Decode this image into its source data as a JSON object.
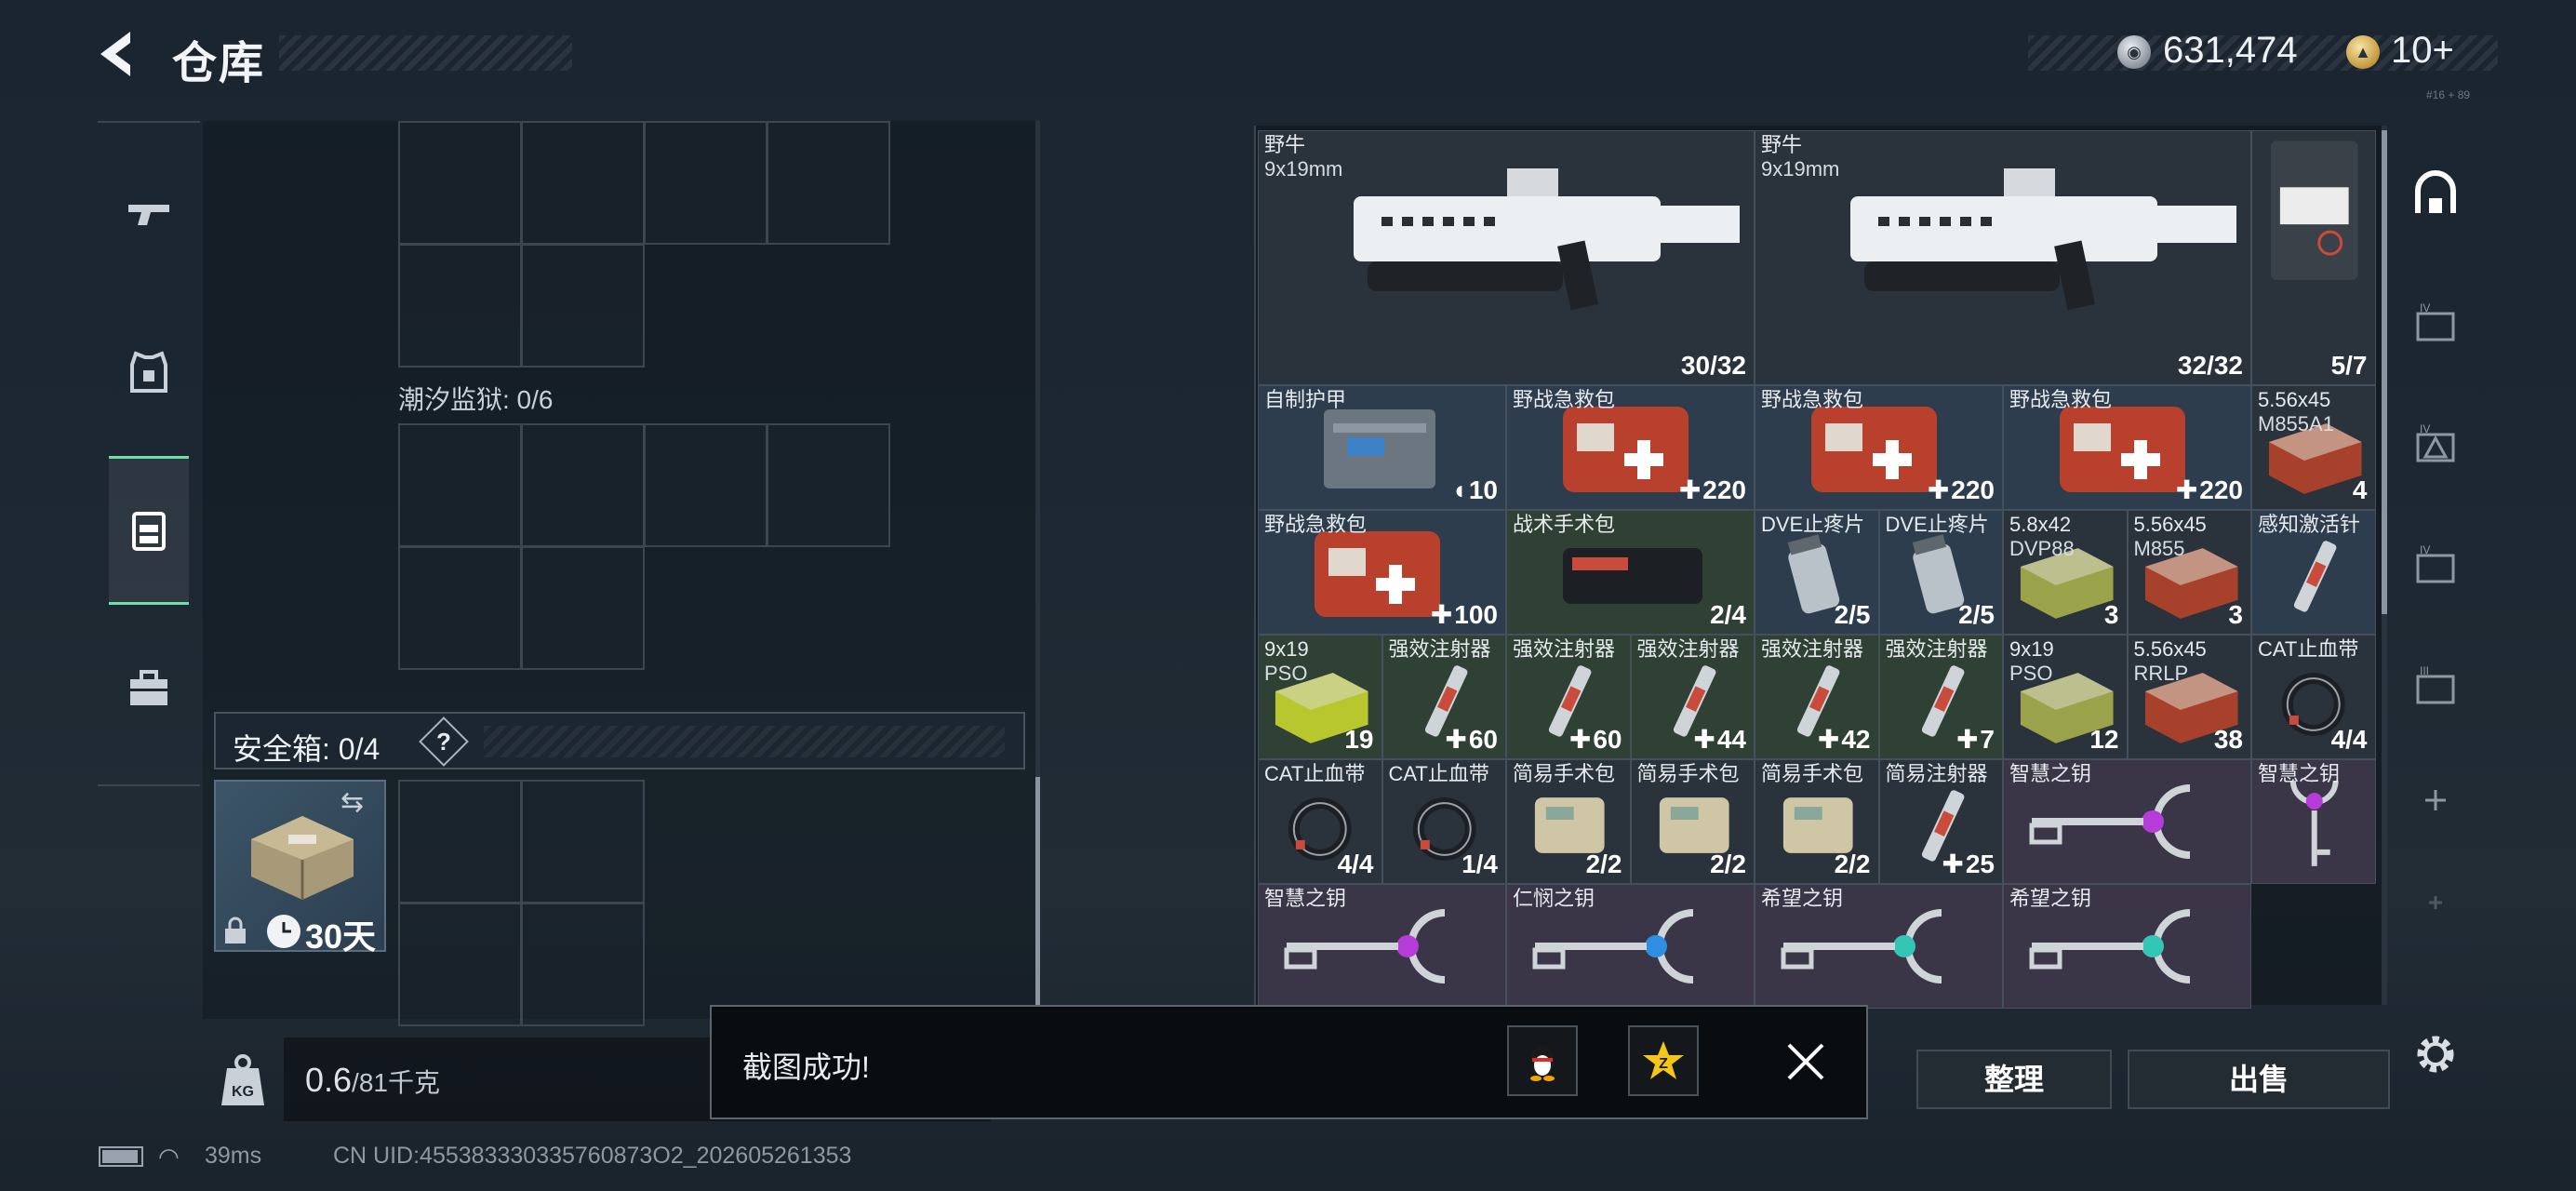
{
  "header": {
    "title": "仓库",
    "silver_amount": "631,474",
    "gold_amount": "10+",
    "version": "#16 + 89"
  },
  "left_panel": {
    "tide_prison_label": "潮汐监狱: 0/6",
    "safe_box_label": "安全箱: 0/4",
    "safe_box_help": "?",
    "safe_box_days": "30天",
    "weight_value": "0.6",
    "weight_unit": "/81千克"
  },
  "status_bar": {
    "ping": "39ms",
    "uid": "CN UID:455383330335760873O2_202605261353"
  },
  "items": [
    {
      "name": "野牛",
      "sub": "9x19mm",
      "count": "30/32",
      "style": "dark"
    },
    {
      "name": "野牛",
      "sub": "9x19mm",
      "count": "32/32",
      "style": "dark"
    },
    {
      "name": "",
      "sub": "",
      "count": "5/7",
      "style": "dark"
    },
    {
      "name": "自制护甲",
      "sub": "",
      "count": "10",
      "style": "blue"
    },
    {
      "name": "野战急救包",
      "sub": "",
      "count": "220",
      "style": "blue"
    },
    {
      "name": "野战急救包",
      "sub": "",
      "count": "220",
      "style": "blue"
    },
    {
      "name": "野战急救包",
      "sub": "",
      "count": "220",
      "style": "blue"
    },
    {
      "name": "5.56x45",
      "sub": "M855A1",
      "count": "4",
      "style": "dark"
    },
    {
      "name": "野战急救包",
      "sub": "",
      "count": "100",
      "style": "blue"
    },
    {
      "name": "战术手术包",
      "sub": "",
      "count": "2/4",
      "style": "green"
    },
    {
      "name": "DVE止疼片",
      "sub": "",
      "count": "2/5",
      "style": "blue"
    },
    {
      "name": "DVE止疼片",
      "sub": "",
      "count": "2/5",
      "style": "blue"
    },
    {
      "name": "5.8x42",
      "sub": "DVP88",
      "count": "3",
      "style": "dark"
    },
    {
      "name": "5.56x45",
      "sub": "M855",
      "count": "3",
      "style": "dark"
    },
    {
      "name": "感知激活针",
      "sub": "",
      "count": "",
      "style": "blue"
    },
    {
      "name": "9x19",
      "sub": "PSO",
      "count": "19",
      "style": "green"
    },
    {
      "name": "强效注射器",
      "sub": "",
      "count": "60",
      "style": "green"
    },
    {
      "name": "强效注射器",
      "sub": "",
      "count": "60",
      "style": "green"
    },
    {
      "name": "强效注射器",
      "sub": "",
      "count": "44",
      "style": "green"
    },
    {
      "name": "强效注射器",
      "sub": "",
      "count": "42",
      "style": "green"
    },
    {
      "name": "强效注射器",
      "sub": "",
      "count": "7",
      "style": "green"
    },
    {
      "name": "9x19",
      "sub": "PSO",
      "count": "12",
      "style": "dark"
    },
    {
      "name": "5.56x45",
      "sub": "RRLP",
      "count": "38",
      "style": "dark"
    },
    {
      "name": "CAT止血带",
      "sub": "",
      "count": "4/4",
      "style": "dark"
    },
    {
      "name": "CAT止血带",
      "sub": "",
      "count": "4/4",
      "style": "dark"
    },
    {
      "name": "CAT止血带",
      "sub": "",
      "count": "1/4",
      "style": "dark"
    },
    {
      "name": "简易手术包",
      "sub": "",
      "count": "2/2",
      "style": "dark"
    },
    {
      "name": "简易手术包",
      "sub": "",
      "count": "2/2",
      "style": "dark"
    },
    {
      "name": "简易手术包",
      "sub": "",
      "count": "2/2",
      "style": "dark"
    },
    {
      "name": "简易注射器",
      "sub": "",
      "count": "25",
      "style": "dark"
    },
    {
      "name": "智慧之钥",
      "sub": "",
      "count": "",
      "style": "purple"
    },
    {
      "name": "智慧之钥",
      "sub": "",
      "count": "",
      "style": "purple"
    },
    {
      "name": "智慧之钥",
      "sub": "",
      "count": "",
      "style": "purple"
    },
    {
      "name": "仁悯之钥",
      "sub": "",
      "count": "",
      "style": "purple"
    },
    {
      "name": "希望之钥",
      "sub": "",
      "count": "",
      "style": "purple"
    },
    {
      "name": "希望之钥",
      "sub": "",
      "count": "",
      "style": "purple"
    }
  ],
  "actions": {
    "sort": "整理",
    "sell": "出售"
  },
  "toast": {
    "message": "截图成功!"
  },
  "colors": {
    "accent_green": "#6ce0a8",
    "tile_blue": "#2d3d4e",
    "tile_green": "#2f4034",
    "tile_purple": "#3a3547",
    "medkit_red": "#b8402c"
  }
}
